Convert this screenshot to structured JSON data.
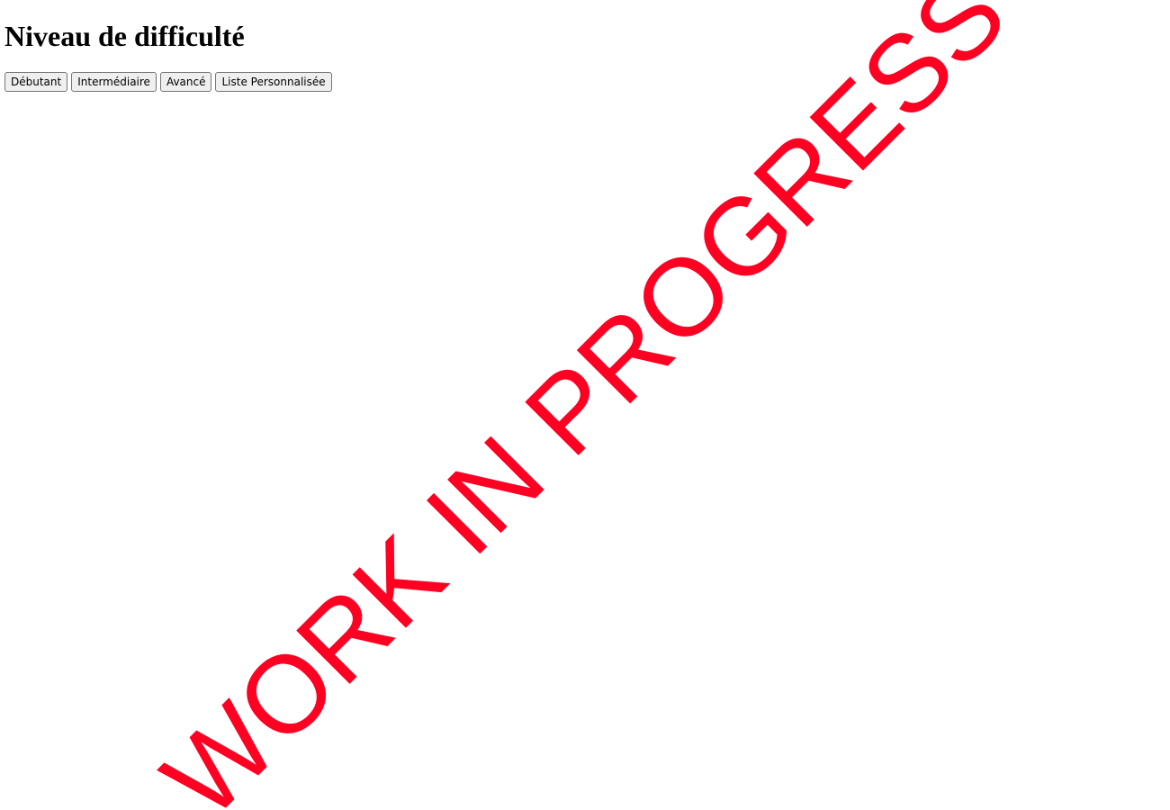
{
  "page": {
    "title": "Niveau de difficulté"
  },
  "levels": {
    "buttons": [
      {
        "label": "Débutant"
      },
      {
        "label": "Intermédiaire"
      },
      {
        "label": "Avancé"
      },
      {
        "label": "Liste Personnalisée"
      }
    ]
  },
  "watermark": {
    "text": "WORK IN PROGRESS",
    "color": "#ff0022"
  }
}
